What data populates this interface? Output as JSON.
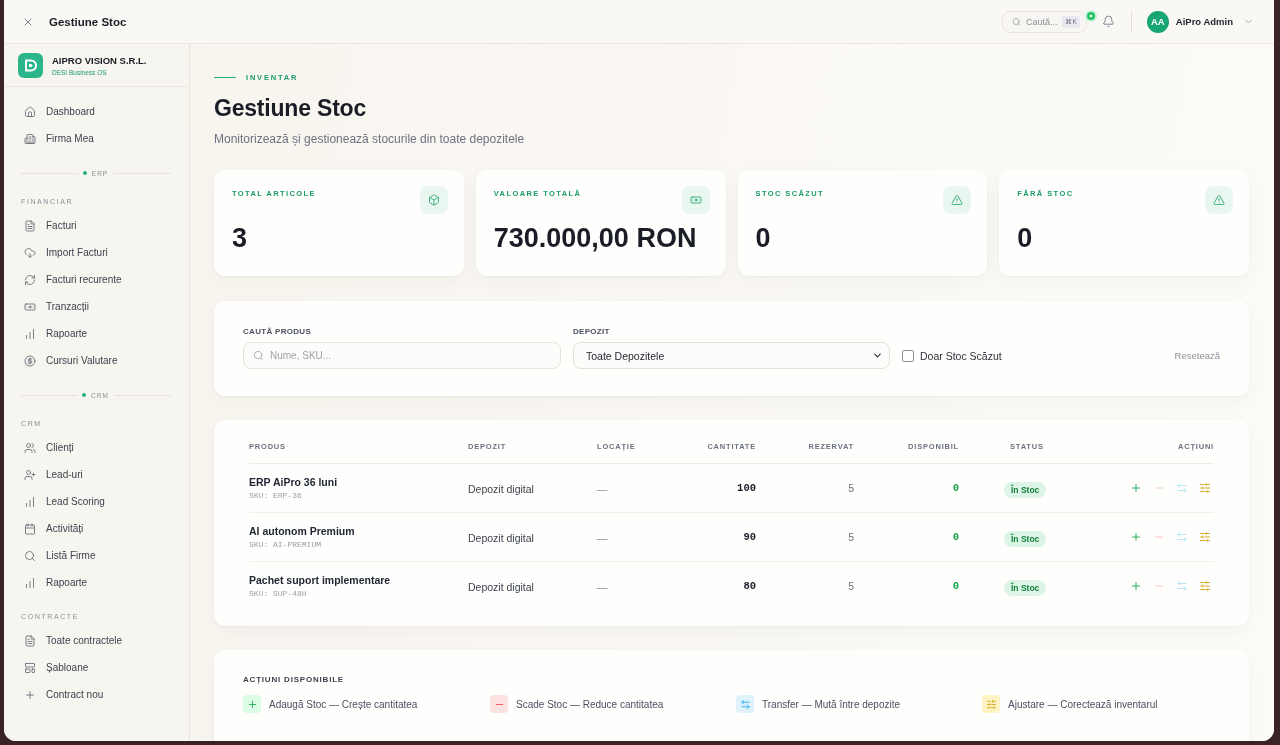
{
  "window": {
    "title": "Gestiune Stoc"
  },
  "topbar": {
    "search": {
      "label": "Caută...",
      "shortcut": "⌘K"
    },
    "user": {
      "initials": "AA",
      "name": "AiPro Admin"
    }
  },
  "sidebar": {
    "company": {
      "name": "AIPRO VISION S.R.L.",
      "tagline": "DESI Business OS"
    },
    "sections": [
      {
        "items": [
          {
            "label": "Dashboard",
            "selected": false
          },
          {
            "label": "Firma Mea",
            "selected": false
          }
        ]
      },
      {
        "divider": "ERP",
        "title": "FINANCIAR",
        "items": [
          {
            "label": "Facturi",
            "selected": false
          },
          {
            "label": "Import Facturi",
            "selected": false
          },
          {
            "label": "Facturi recurente",
            "selected": false
          },
          {
            "label": "Tranzacții",
            "selected": false
          },
          {
            "label": "Rapoarte",
            "selected": false
          },
          {
            "label": "Cursuri Valutare",
            "selected": false
          }
        ]
      },
      {
        "divider": "CRM",
        "title": "CRM",
        "items": [
          {
            "label": "Clienți",
            "selected": false
          },
          {
            "label": "Lead-uri",
            "selected": false
          },
          {
            "label": "Lead Scoring",
            "selected": false
          },
          {
            "label": "Activități",
            "selected": false
          },
          {
            "label": "Listă Firme",
            "selected": false
          },
          {
            "label": "Rapoarte",
            "selected": false
          }
        ]
      },
      {
        "title": "CONTRACTE",
        "items": [
          {
            "label": "Toate contractele",
            "selected": false
          },
          {
            "label": "Șabloane",
            "selected": false
          },
          {
            "label": "Contract nou",
            "selected": false
          }
        ]
      }
    ]
  },
  "page": {
    "eyebrow": "INVENTAR",
    "title": "Gestiune Stoc",
    "subtitle": "Monitorizează și gestionează stocurile din toate depozitele"
  },
  "stats": [
    {
      "label": "TOTAL ARTICOLE",
      "value": "3"
    },
    {
      "label": "VALOARE TOTALĂ",
      "value": "730.000,00 RON"
    },
    {
      "label": "STOC SCĂZUT",
      "value": "0"
    },
    {
      "label": "FĂRĂ STOC",
      "value": "0"
    }
  ],
  "filters": {
    "search": {
      "label": "CAUTĂ PRODUS",
      "placeholder": "Nume, SKU..."
    },
    "warehouse": {
      "label": "DEPOZIT",
      "value": "Toate Depozitele"
    },
    "low_stock_only": {
      "label": "Doar Stoc Scăzut",
      "checked": false
    },
    "reset": "Resetează"
  },
  "table": {
    "columns": [
      "PRODUS",
      "DEPOZIT",
      "LOCAȚIE",
      "CANTITATE",
      "REZERVAT",
      "DISPONIBIL",
      "STATUS",
      "ACȚIUNI"
    ],
    "rows": [
      {
        "product": "ERP AiPro 36 luni",
        "sku": "SKU: ERP-36",
        "warehouse": "Depozit digital",
        "location": "—",
        "quantity": "100",
        "reserved": "5",
        "available": "0",
        "status": "În Stoc",
        "actions": [
          {
            "kind": "add",
            "disabled": false
          },
          {
            "kind": "remove",
            "disabled": true
          },
          {
            "kind": "transfer",
            "disabled": true
          },
          {
            "kind": "adjust",
            "disabled": false
          }
        ]
      },
      {
        "product": "AI autonom Premium",
        "sku": "SKU: AI-PREMIUM",
        "warehouse": "Depozit digital",
        "location": "—",
        "quantity": "90",
        "reserved": "5",
        "available": "0",
        "status": "În Stoc",
        "actions": [
          {
            "kind": "add",
            "disabled": false
          },
          {
            "kind": "remove",
            "disabled": true
          },
          {
            "kind": "transfer",
            "disabled": true
          },
          {
            "kind": "adjust",
            "disabled": false
          }
        ]
      },
      {
        "product": "Pachet suport implementare",
        "sku": "SKU: SUP-48H",
        "warehouse": "Depozit digital",
        "location": "—",
        "quantity": "80",
        "reserved": "5",
        "available": "0",
        "status": "În Stoc",
        "actions": [
          {
            "kind": "add",
            "disabled": false
          },
          {
            "kind": "remove",
            "disabled": true
          },
          {
            "kind": "transfer",
            "disabled": true
          },
          {
            "kind": "adjust",
            "disabled": false
          }
        ]
      }
    ]
  },
  "legend": {
    "title": "ACȚIUNI DISPONIBILE",
    "items": [
      {
        "kind": "add",
        "label": "Adaugă Stoc — Crește cantitatea"
      },
      {
        "kind": "remove",
        "label": "Scade Stoc — Reduce cantitatea"
      },
      {
        "kind": "transfer",
        "label": "Transfer — Mută între depozite"
      },
      {
        "kind": "adjust",
        "label": "Ajustare — Corectează inventarul"
      }
    ]
  }
}
